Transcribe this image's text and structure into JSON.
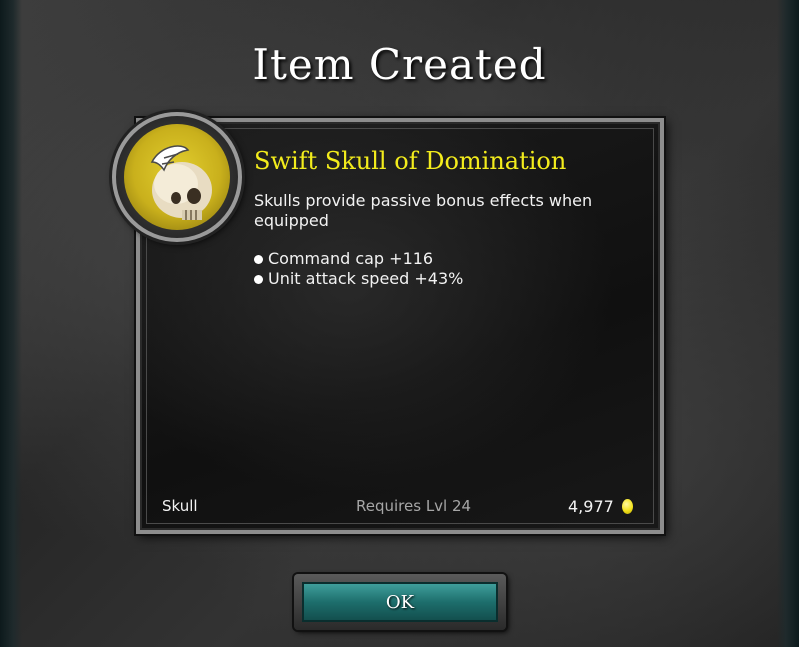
{
  "dialog": {
    "title": "Item Created",
    "ok_label": "OK"
  },
  "item": {
    "icon": "skull-icon",
    "name": "Swift Skull of Domination",
    "description": "Skulls provide passive bonus effects when equipped",
    "stats": [
      "Command cap +116",
      "Unit attack speed +43%"
    ],
    "type": "Skull",
    "requirement": "Requires Lvl 24",
    "price": "4,977",
    "currency_icon": "gold-coin-icon"
  },
  "colors": {
    "item_name": "#f3ec1c",
    "button": "#1d6e6c",
    "requirement": "#a6a6a6"
  }
}
